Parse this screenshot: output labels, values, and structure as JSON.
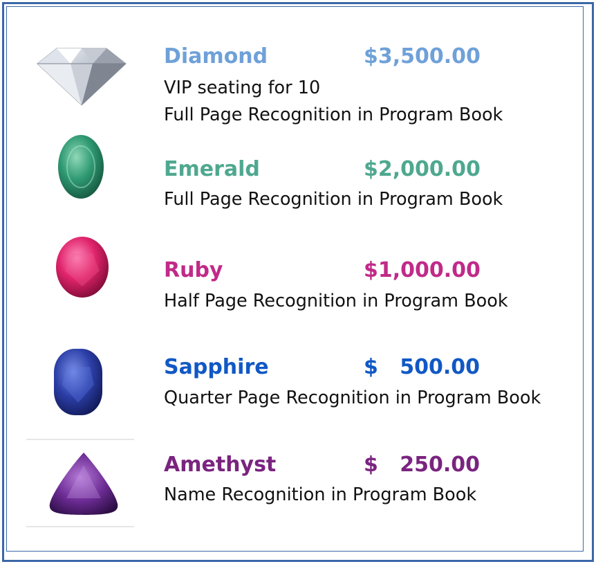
{
  "tiers": [
    {
      "id": "diamond",
      "name": "Diamond",
      "price": "$3,500.00",
      "color": "#6fa1d8",
      "benefits": [
        "VIP seating for 10",
        "Full Page Recognition in Program Book"
      ],
      "gem_icon": "diamond-icon"
    },
    {
      "id": "emerald",
      "name": "Emerald",
      "price": "$2,000.00",
      "color": "#4ea88f",
      "benefits": [
        "Full Page Recognition in Program Book"
      ],
      "gem_icon": "emerald-icon"
    },
    {
      "id": "ruby",
      "name": "Ruby",
      "price": "$1,000.00",
      "color": "#c02a88",
      "benefits": [
        "Half Page Recognition in Program Book"
      ],
      "gem_icon": "ruby-icon"
    },
    {
      "id": "sapphire",
      "name": "Sapphire",
      "price": "$   500.00",
      "color": "#1158c4",
      "benefits": [
        "Quarter Page Recognition in Program Book"
      ],
      "gem_icon": "sapphire-icon"
    },
    {
      "id": "amethyst",
      "name": "Amethyst",
      "price": "$   250.00",
      "color": "#7a2480",
      "benefits": [
        "Name Recognition in Program Book"
      ],
      "gem_icon": "amethyst-icon"
    }
  ],
  "colors": {
    "border": "#3b67a8"
  }
}
